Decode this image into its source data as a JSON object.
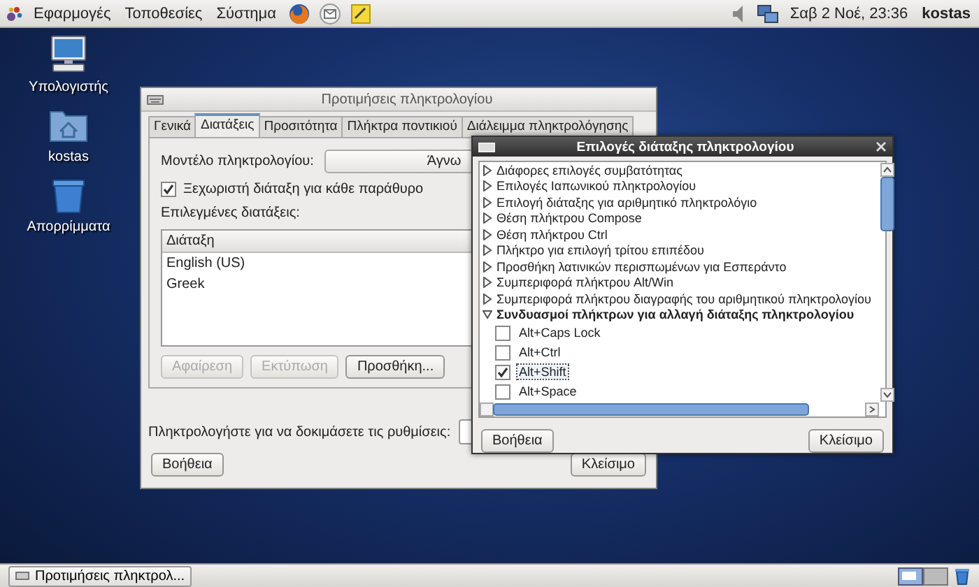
{
  "top_panel": {
    "menus": [
      "Εφαρμογές",
      "Τοποθεσίες",
      "Σύστημα"
    ],
    "clock": "Σαβ 2 Νοέ, 23:36",
    "user": "kostas"
  },
  "desktop_icons": [
    {
      "kind": "computer",
      "label": "Υπολογιστής"
    },
    {
      "kind": "folder",
      "label": "kostas"
    },
    {
      "kind": "trash",
      "label": "Απορρίμματα"
    }
  ],
  "keyboard_window": {
    "title": "Προτιμήσεις πληκτρολογίου",
    "tabs": [
      {
        "label": "Γενικά",
        "selected": false
      },
      {
        "label": "Διατάξεις",
        "selected": true
      },
      {
        "label": "Προσιτότητα",
        "selected": false
      },
      {
        "label": "Πλήκτρα ποντικιού",
        "selected": false
      },
      {
        "label": "Διάλειμμα πληκτρολόγησης",
        "selected": false
      }
    ],
    "model_label": "Μοντέλο πληκτρολογίου:",
    "model_value": "Άγνω",
    "separate_layout": {
      "label": "Ξεχωριστή διάταξη για κάθε παράθυρο",
      "checked": true
    },
    "selected_layouts_label": "Επιλεγμένες διατάξεις:",
    "layouts_table": {
      "columns": [
        "Διάταξη"
      ],
      "rows": [
        "English (US)",
        "Greek"
      ]
    },
    "buttons": [
      {
        "label": "Αφαίρεση",
        "disabled": true
      },
      {
        "label": "Εκτύπωση",
        "disabled": true
      },
      {
        "label": "Προσθήκη...",
        "disabled": false
      }
    ],
    "test_label": "Πληκτρολογήστε για να δοκιμάσετε τις ρυθμίσεις:",
    "help_button": "Βοήθεια",
    "close_button": "Κλείσιμο"
  },
  "options_dialog": {
    "title": "Επιλογές διάταξης πληκτρολογίου",
    "options": [
      {
        "label": "Διάφορες επιλογές συμβατότητας",
        "expanded": false
      },
      {
        "label": "Επιλογές Ιαπωνικού πληκτρολογίου",
        "expanded": false
      },
      {
        "label": "Επιλογή διάταξης για αριθμητικό πληκτρολόγιο",
        "expanded": false
      },
      {
        "label": "Θέση πλήκτρου Compose",
        "expanded": false
      },
      {
        "label": "Θέση πλήκτρου Ctrl",
        "expanded": false
      },
      {
        "label": "Πλήκτρο για επιλογή τρίτου επιπέδου",
        "expanded": false
      },
      {
        "label": "Προσθήκη λατινικών περισπωμένων για Εσπεράντο",
        "expanded": false
      },
      {
        "label": "Συμπεριφορά πλήκτρου Alt/Win",
        "expanded": false
      },
      {
        "label": "Συμπεριφορά πλήκτρου διαγραφής του αριθμητικού πληκτρολογίου",
        "expanded": false
      },
      {
        "label": "Συνδυασμοί πλήκτρων για αλλαγή διάταξης πληκτρολογίου",
        "expanded": true,
        "children": [
          {
            "label": "Alt+Caps Lock",
            "checked": false,
            "selected": false
          },
          {
            "label": "Alt+Ctrl",
            "checked": false,
            "selected": false
          },
          {
            "label": "Alt+Shift",
            "checked": true,
            "selected": true
          },
          {
            "label": "Alt+Space",
            "checked": false,
            "selected": false
          }
        ]
      }
    ],
    "help_button": "Βοήθεια",
    "close_button": "Κλείσιμο"
  },
  "taskbar": {
    "tasks": [
      {
        "label": "Προτιμήσεις πληκτρολ...",
        "selected": false
      }
    ]
  }
}
